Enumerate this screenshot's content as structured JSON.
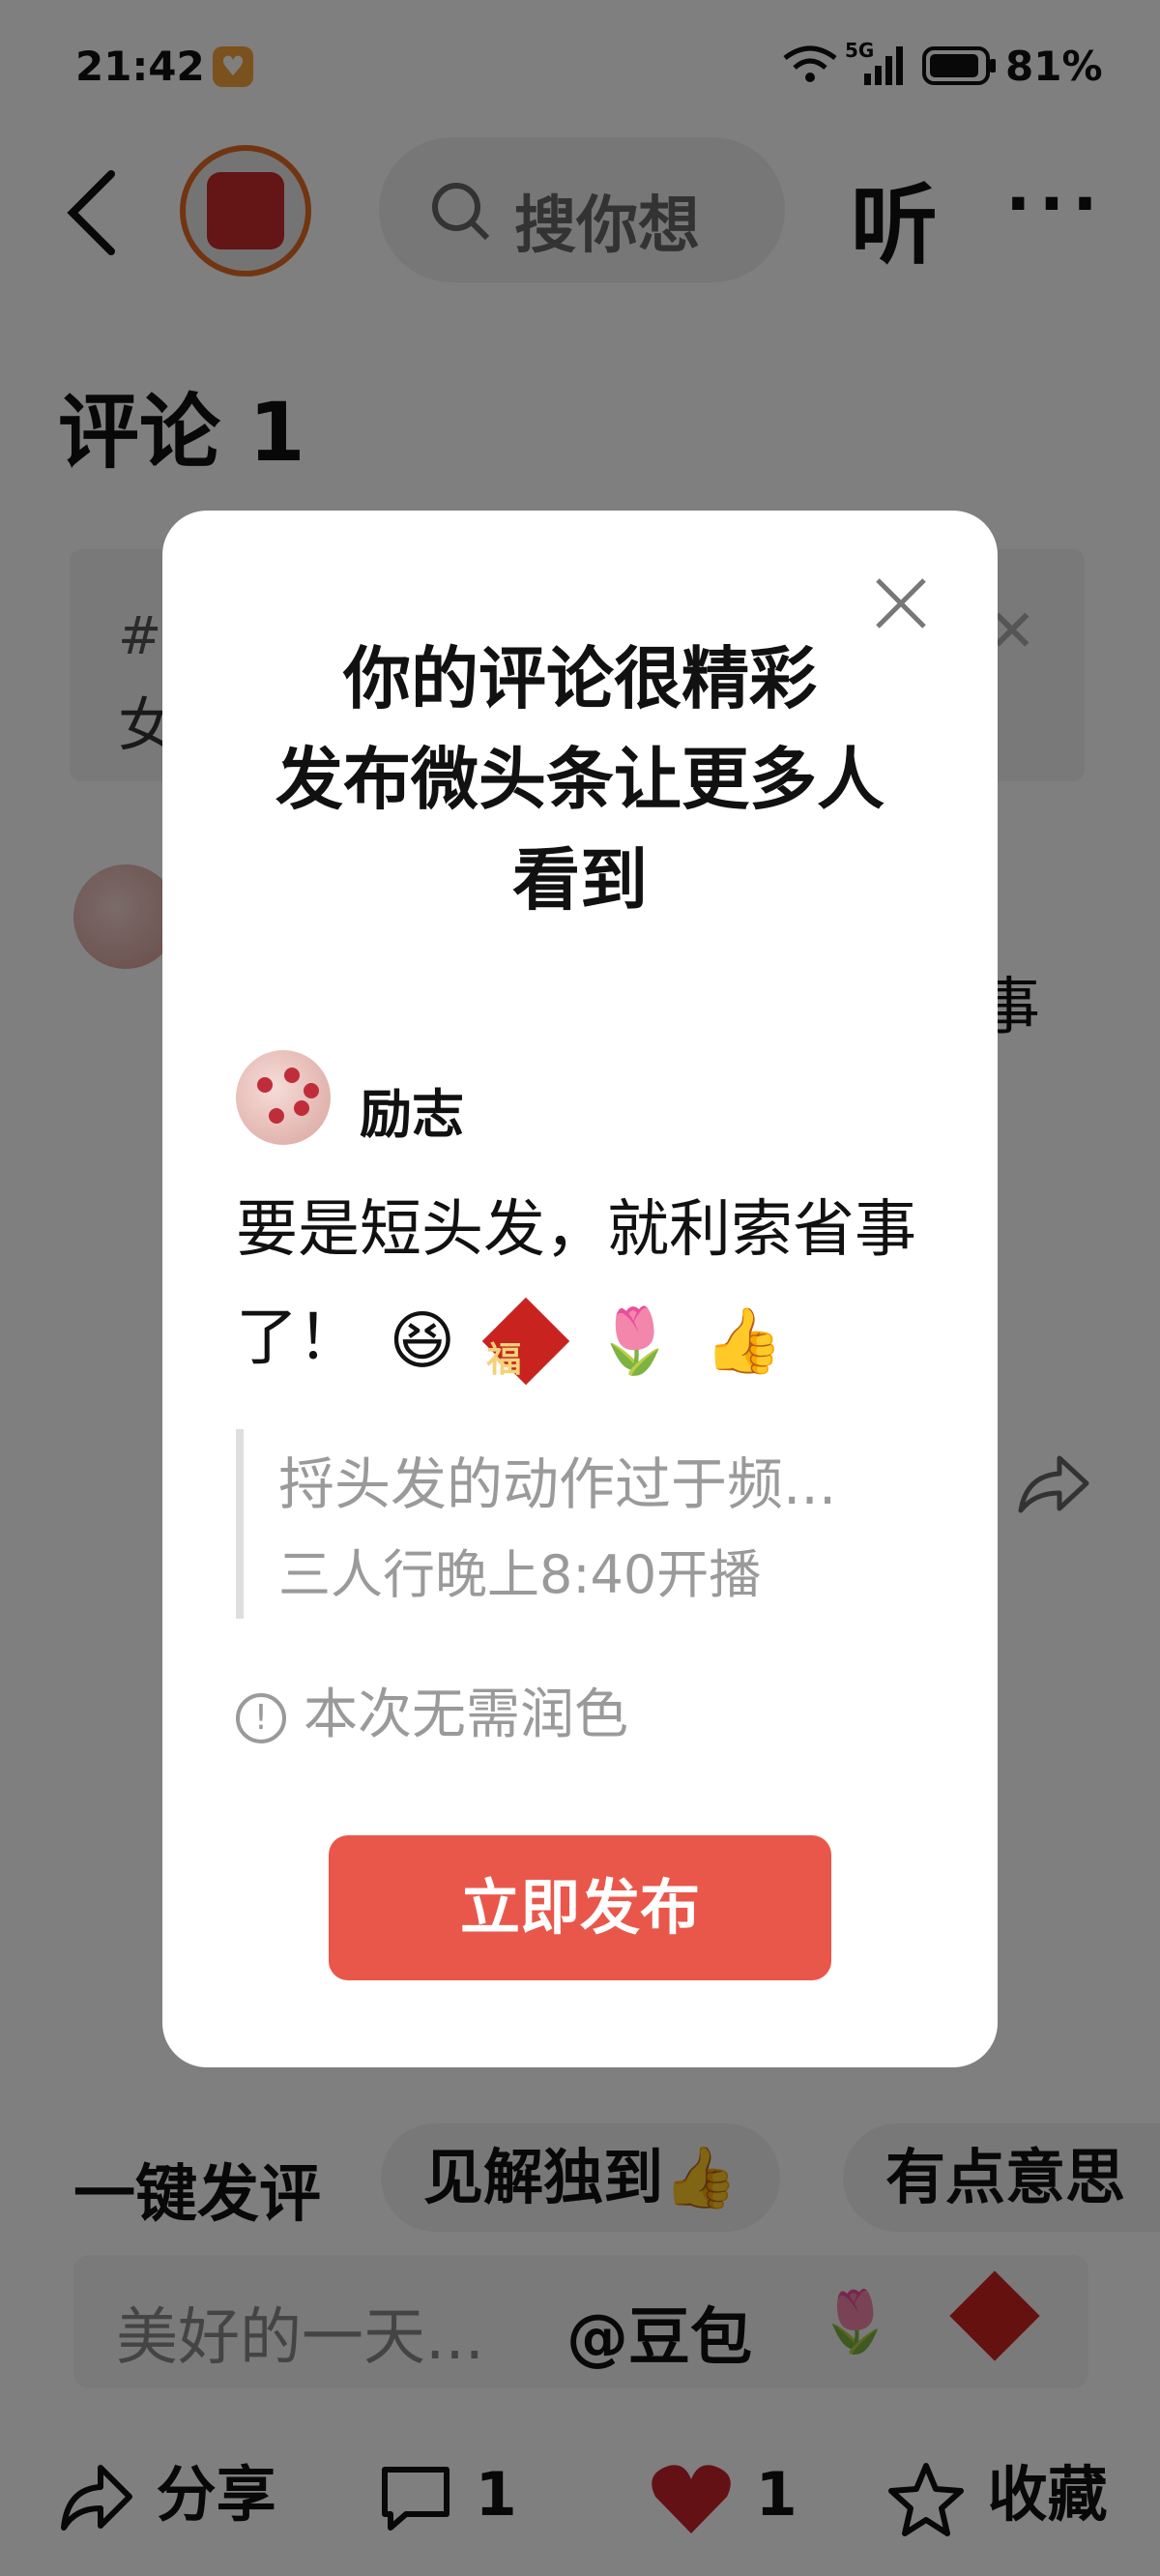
{
  "status_bar": {
    "time": "21:42",
    "network": "5G",
    "battery": "81%"
  },
  "header": {
    "search_placeholder": "搜你想",
    "listen": "听",
    "more": "···"
  },
  "section": {
    "title": "评论 1"
  },
  "banner": {
    "line1": "#",
    "line2": "女"
  },
  "comment": {
    "truncated_char": "事"
  },
  "quick_reply": {
    "label": "一键发评",
    "chips": [
      "见解独到👍",
      "有点意思"
    ]
  },
  "input_bar": {
    "placeholder": "美好的一天...",
    "mention": "@豆包",
    "emoji1": "🌷"
  },
  "bottom_bar": {
    "share": "分享",
    "comment_count": "1",
    "like_count": "1",
    "favorite": "收藏"
  },
  "modal": {
    "title_lines": [
      "你的评论很精彩",
      "发布微头条让更多人",
      "看到"
    ],
    "user_name": "励志",
    "comment_text": "要是短头发，就利索省事了！",
    "emojis": [
      "😆",
      "福",
      "🌷",
      "👍"
    ],
    "quote_title": "捋头发的动作过于频...",
    "quote_source": "三人行晚上8:40开播",
    "note": "本次无需润色",
    "publish_button": "立即发布"
  },
  "colors": {
    "accent": "#e9574b",
    "like": "#c8232b"
  }
}
